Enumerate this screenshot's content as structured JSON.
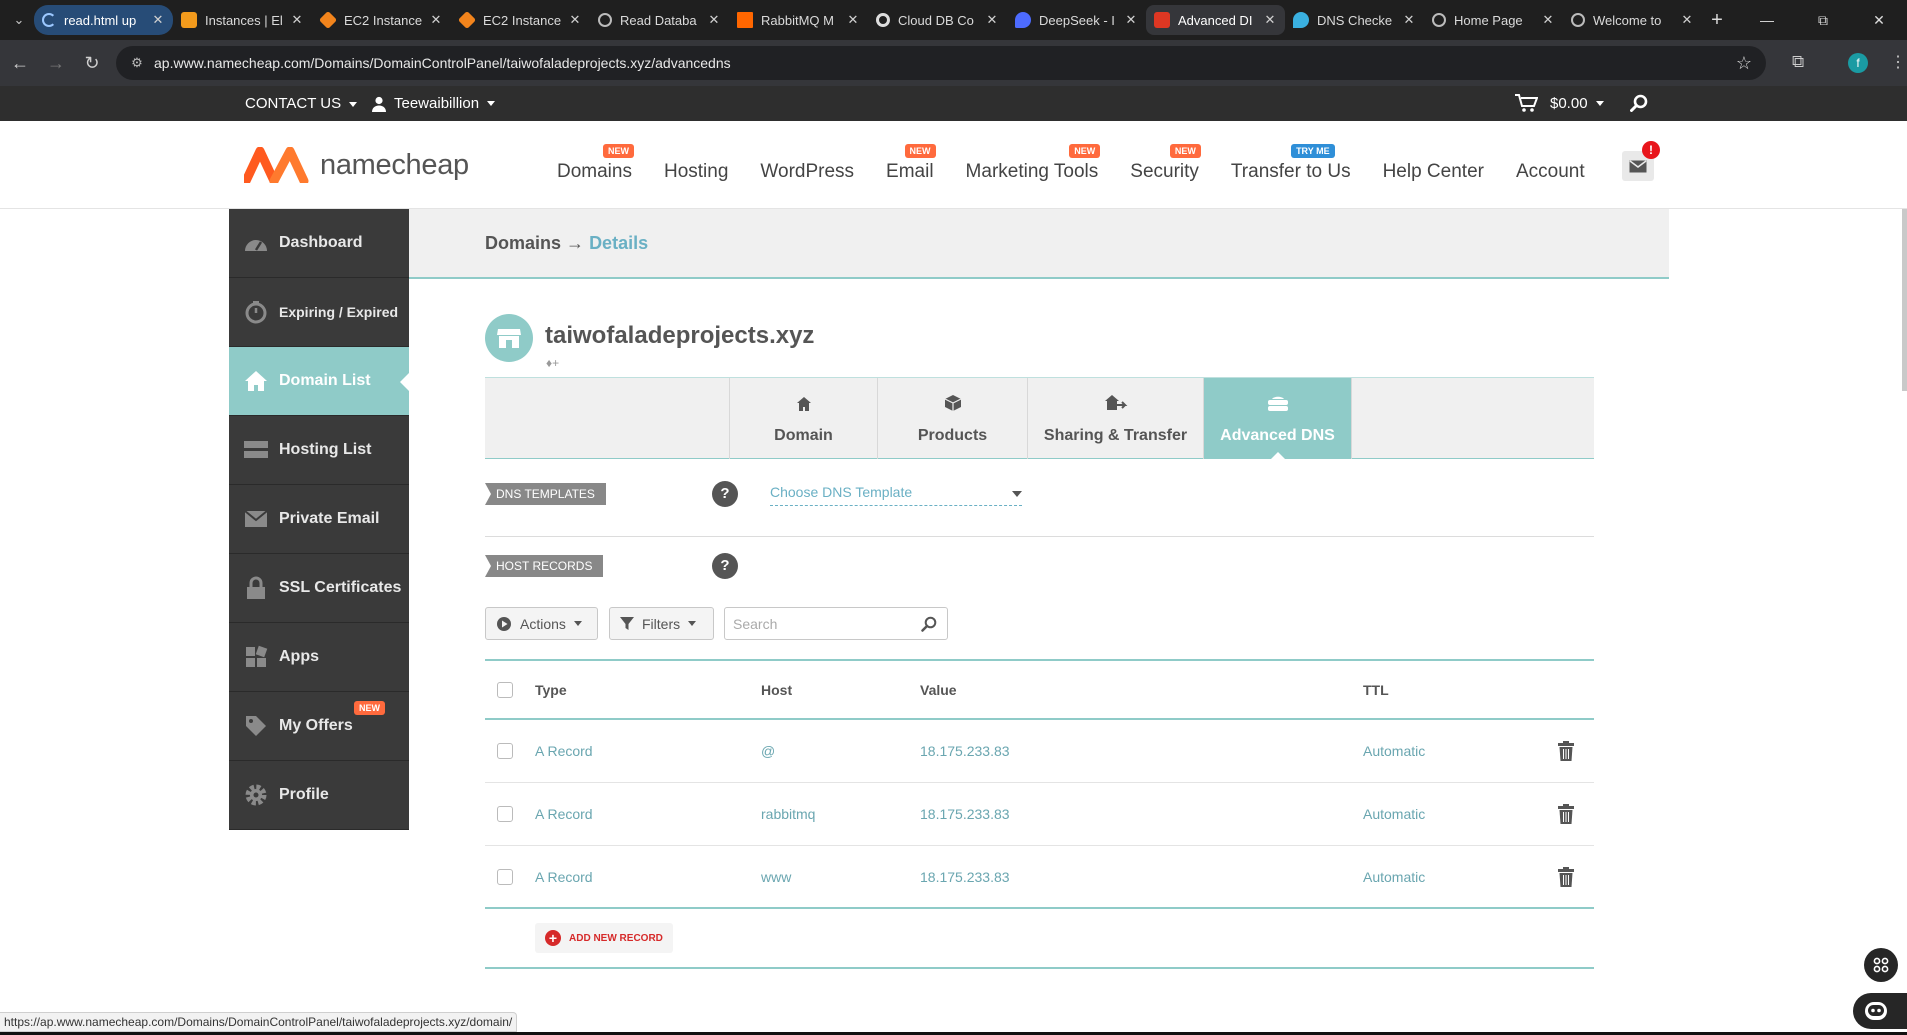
{
  "browser": {
    "tabs": [
      {
        "label": "read.html up",
        "color": "#5aa0e6"
      },
      {
        "label": "Instances | El",
        "color": "#f29a1c"
      },
      {
        "label": "EC2 Instance",
        "color": "#f2841c"
      },
      {
        "label": "EC2 Instance",
        "color": "#f2841c"
      },
      {
        "label": "Read Databa",
        "color": "#bbbbbb"
      },
      {
        "label": "RabbitMQ M",
        "color": "#ff6600"
      },
      {
        "label": "Cloud DB Co",
        "color": "#dddddd"
      },
      {
        "label": "DeepSeek - I",
        "color": "#4d6bfe"
      },
      {
        "label": "Advanced DI",
        "color": "#de3723"
      },
      {
        "label": "DNS Checke",
        "color": "#3ab0e0"
      },
      {
        "label": "Home Page",
        "color": "#bbbbbb"
      },
      {
        "label": "Welcome to",
        "color": "#bbbbbb"
      }
    ],
    "url": "ap.www.namecheap.com/Domains/DomainControlPanel/taiwofaladeprojects.xyz/advancedns",
    "profile_initial": "f"
  },
  "topbar": {
    "contact": "CONTACT US",
    "username": "Teewaibillion",
    "cart_total": "$0.00"
  },
  "header": {
    "logo_text": "namecheap",
    "nav": [
      {
        "label": "Domains",
        "badge": "NEW"
      },
      {
        "label": "Hosting",
        "badge": ""
      },
      {
        "label": "WordPress",
        "badge": ""
      },
      {
        "label": "Email",
        "badge": "NEW"
      },
      {
        "label": "Marketing Tools",
        "badge": "NEW"
      },
      {
        "label": "Security",
        "badge": "NEW"
      },
      {
        "label": "Transfer to Us",
        "badge": "TRY ME"
      },
      {
        "label": "Help Center",
        "badge": ""
      },
      {
        "label": "Account",
        "badge": ""
      }
    ],
    "mail_alert": "!"
  },
  "sidebar": {
    "items": [
      {
        "label": "Dashboard"
      },
      {
        "label": "Expiring / Expired"
      },
      {
        "label": "Domain List"
      },
      {
        "label": "Hosting List"
      },
      {
        "label": "Private Email"
      },
      {
        "label": "SSL Certificates"
      },
      {
        "label": "Apps"
      },
      {
        "label": "My Offers",
        "badge": "NEW"
      },
      {
        "label": "Profile"
      }
    ]
  },
  "breadcrumb": {
    "root": "Domains",
    "arrow": "→",
    "current": "Details"
  },
  "domain": {
    "name": "taiwofaladeprojects.xyz"
  },
  "tabs": [
    {
      "label": "Domain"
    },
    {
      "label": "Products"
    },
    {
      "label": "Sharing & Transfer"
    },
    {
      "label": "Advanced DNS"
    }
  ],
  "dns_templates": {
    "label": "DNS TEMPLATES",
    "help": "?",
    "select_value": "Choose DNS Template"
  },
  "host_records": {
    "label": "HOST RECORDS",
    "help": "?"
  },
  "toolbar": {
    "actions": "Actions",
    "filters": "Filters",
    "search_placeholder": "Search"
  },
  "table": {
    "headers": {
      "type": "Type",
      "host": "Host",
      "value": "Value",
      "ttl": "TTL"
    },
    "rows": [
      {
        "type": "A Record",
        "host": "@",
        "value": "18.175.233.83",
        "ttl": "Automatic"
      },
      {
        "type": "A Record",
        "host": "rabbitmq",
        "value": "18.175.233.83",
        "ttl": "Automatic"
      },
      {
        "type": "A Record",
        "host": "www",
        "value": "18.175.233.83",
        "ttl": "Automatic"
      }
    ],
    "add_label": "ADD NEW RECORD"
  },
  "status_url": "https://ap.www.namecheap.com/Domains/DomainControlPanel/taiwofaladeprojects.xyz/domain/"
}
